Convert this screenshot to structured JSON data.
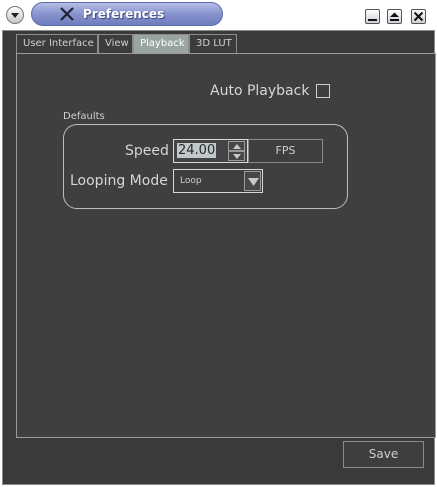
{
  "window": {
    "title": "Preferences",
    "icons": {
      "menu": "window-menu-icon",
      "app": "app-icon",
      "minimize": "minimize-icon",
      "maximize": "maximize-icon",
      "close": "close-icon"
    }
  },
  "tabs": [
    {
      "label": "User Interface",
      "active": false
    },
    {
      "label": "View",
      "active": false
    },
    {
      "label": "Playback",
      "active": true
    },
    {
      "label": "3D LUT",
      "active": false
    }
  ],
  "playback": {
    "auto_playback_label": "Auto Playback",
    "auto_playback_checked": false,
    "defaults_group_label": "Defaults",
    "speed_label": "Speed",
    "speed_value": "24.00",
    "fps_button_label": "FPS",
    "looping_mode_label": "Looping Mode",
    "looping_mode_value": "Loop"
  },
  "footer": {
    "save_label": "Save"
  },
  "colors": {
    "background": "#3f3f3f",
    "title_gradient": "#8a96cf",
    "active_tab": "#9aa4a2",
    "text": "#d6d6d6"
  }
}
